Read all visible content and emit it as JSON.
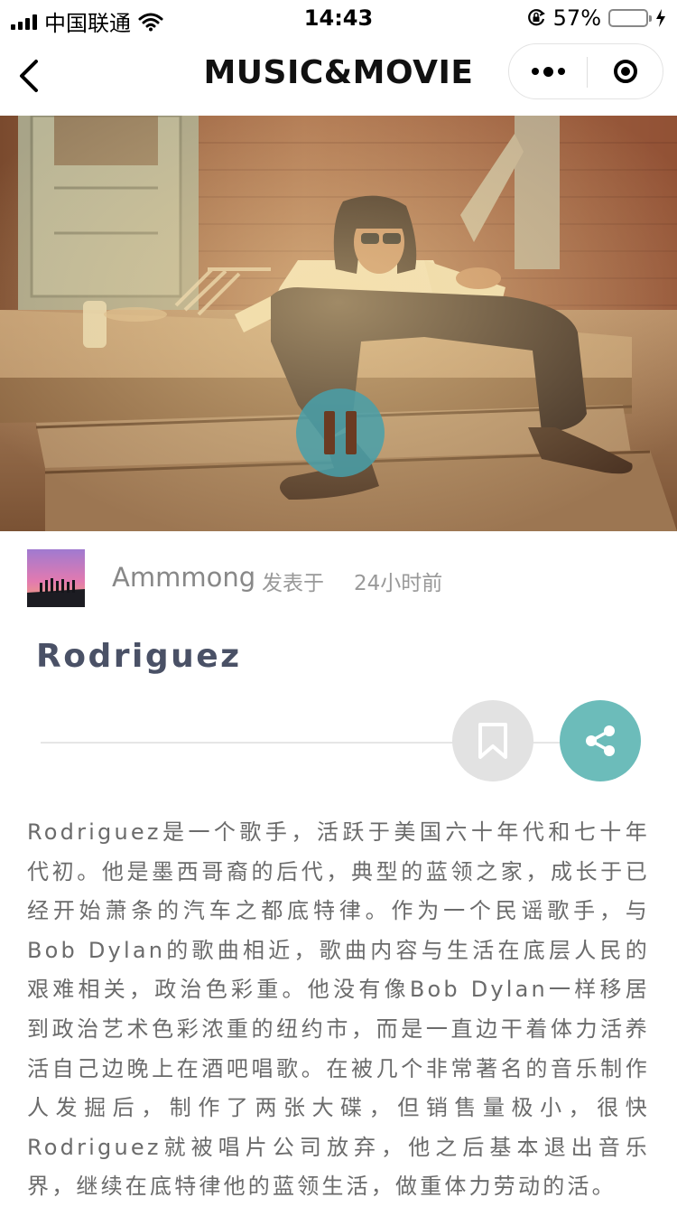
{
  "status_bar": {
    "carrier": "中国联通",
    "time": "14:43",
    "battery_percent": "57%",
    "battery_level": 0.57,
    "icons": [
      "signal-icon",
      "wifi-icon",
      "orientation-lock-icon",
      "battery-icon",
      "charging-icon"
    ]
  },
  "nav": {
    "title": "MUSIC&MOVIE",
    "icons": [
      "back-icon",
      "more-icon",
      "close-icon"
    ]
  },
  "hero": {
    "image_subject": "man in sunglasses sitting on wooden porch steps",
    "icons": [
      "pause-icon"
    ],
    "accent": "#48a0aa"
  },
  "author": {
    "name": "Ammmong",
    "posted_label": "发表于",
    "posted_time": "24小时前"
  },
  "article": {
    "title": "Rodriguez",
    "body": "Rodriguez是一个歌手，活跃于美国六十年代和七十年代初。他是墨西哥裔的后代，典型的蓝领之家，成长于已经开始萧条的汽车之都底特律。作为一个民谣歌手，与Bob Dylan的歌曲相近，歌曲内容与生活在底层人民的艰难相关，政治色彩重。他没有像Bob Dylan一样移居到政治艺术色彩浓重的纽约市，而是一直边干着体力活养活自己边晚上在酒吧唱歌。在被几个非常著名的音乐制作人发掘后，制作了两张大碟，但销售量极小，很快Rodriguez就被唱片公司放弃，他之后基本退出音乐界，继续在底特律他的蓝领生活，做重体力劳动的活。"
  },
  "actions": {
    "icons": [
      "bookmark-icon",
      "share-icon"
    ],
    "share_color": "#6cbcba",
    "bookmark_color": "#e2e2e2"
  }
}
